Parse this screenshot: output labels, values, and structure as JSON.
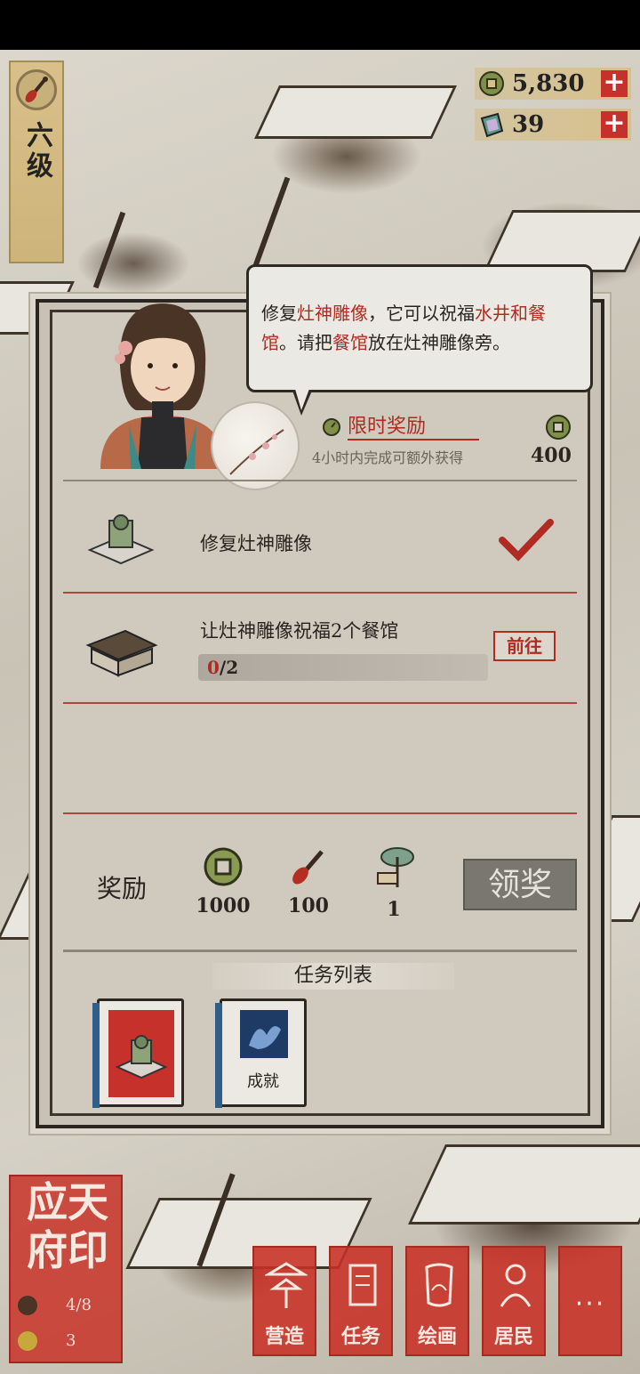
{
  "player": {
    "level_label": "六级"
  },
  "currency": {
    "coins": "5,830",
    "gems": "39",
    "plus": "+"
  },
  "dialog": {
    "part1": "修复",
    "hl1": "灶神雕像",
    "part2": "，它可以祝福",
    "hl2": "水井和餐馆",
    "part3": "。请把",
    "hl3": "餐馆",
    "part4": "放在灶神雕像旁。"
  },
  "timed_reward": {
    "title": "限时奖励",
    "subtitle": "4小时内完成可额外获得",
    "amount": "400"
  },
  "tasks": [
    {
      "label": "修复灶神雕像",
      "done": true
    },
    {
      "label": "让灶神雕像祝福2个餐馆",
      "progress_current": "0",
      "progress_total": "/2",
      "goto_label": "前往"
    }
  ],
  "rewards": {
    "label": "奖励",
    "items": [
      {
        "icon": "coin-icon",
        "value": "1000"
      },
      {
        "icon": "brush-icon",
        "value": "100"
      },
      {
        "icon": "umbrella-stall-icon",
        "value": "1"
      }
    ],
    "claim_label": "领奖"
  },
  "task_list": {
    "title": "任务列表",
    "books": [
      {
        "name": "main-quest-book",
        "label": ""
      },
      {
        "name": "achievement-book",
        "label": "成就"
      }
    ]
  },
  "city": {
    "name": "应天府印",
    "population": "4/8",
    "coins": "3"
  },
  "nav": [
    {
      "label": "营造"
    },
    {
      "label": "任务"
    },
    {
      "label": "绘画"
    },
    {
      "label": "居民"
    },
    {
      "label": "···"
    }
  ],
  "colors": {
    "accent_red": "#b02c22",
    "button_red": "#c7312b",
    "parchment": "#cfc9be"
  }
}
